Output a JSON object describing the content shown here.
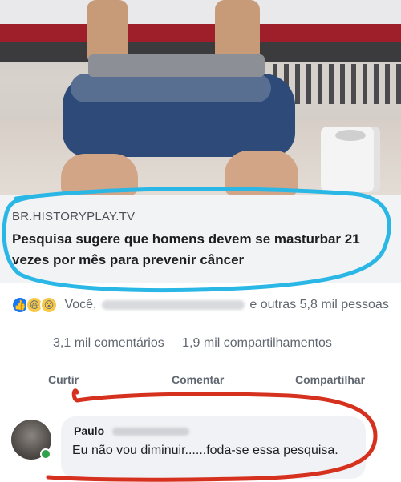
{
  "link_preview": {
    "domain": "BR.HISTORYPLAY.TV",
    "title": "Pesquisa sugere que homens devem se masturbar 21 vezes por mês para prevenir câncer"
  },
  "reactions": {
    "icons": [
      "like-icon",
      "haha-icon",
      "wow-icon"
    ],
    "prefix": "Você,",
    "suffix": "e outras 5,8 mil pessoas",
    "comments_count": "3,1 mil comentários",
    "shares_count": "1,9 mil compartilhamentos"
  },
  "actions": {
    "like_label": "Curtir",
    "comment_label": "Comentar",
    "share_label": "Compartilhar"
  },
  "comment": {
    "author_first_name": "Paulo",
    "text": "Eu não vou diminuir......foda-se essa pesquisa."
  },
  "colors": {
    "annotation_blue": "#2bb7e6",
    "annotation_red": "#d6311f",
    "online_green": "#31a24c",
    "like_blue": "#1877f2"
  }
}
